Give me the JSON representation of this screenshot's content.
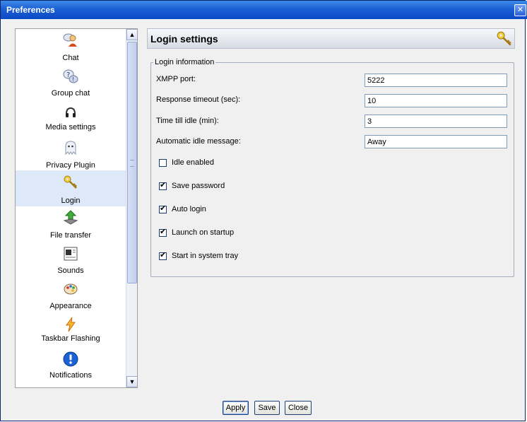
{
  "window": {
    "title": "Preferences",
    "close_glyph": "✕"
  },
  "sidebar": {
    "items": [
      {
        "label": "Chat",
        "icon": "chat-users-icon"
      },
      {
        "label": "Group chat",
        "icon": "group-chat-icon"
      },
      {
        "label": "Media settings",
        "icon": "headset-icon"
      },
      {
        "label": "Privacy Plugin",
        "icon": "ghost-icon"
      },
      {
        "label": "Login",
        "icon": "key-icon",
        "selected": true
      },
      {
        "label": "File transfer",
        "icon": "file-transfer-icon"
      },
      {
        "label": "Sounds",
        "icon": "sounds-icon"
      },
      {
        "label": "Appearance",
        "icon": "palette-icon"
      },
      {
        "label": "Taskbar Flashing",
        "icon": "lightning-icon"
      },
      {
        "label": "Notifications",
        "icon": "info-icon"
      }
    ],
    "scroll_up": "▲",
    "scroll_down": "▼"
  },
  "panel": {
    "title": "Login settings",
    "group_label": "Login information",
    "fields": [
      {
        "label": "XMPP port:",
        "value": "5222"
      },
      {
        "label": "Response timeout (sec):",
        "value": "10"
      },
      {
        "label": "Time till idle (min):",
        "value": "3"
      },
      {
        "label": "Automatic idle message:",
        "value": "Away"
      }
    ],
    "checkboxes": [
      {
        "label": "Idle enabled",
        "checked": false
      },
      {
        "label": "Save password",
        "checked": true
      },
      {
        "label": "Auto login",
        "checked": true
      },
      {
        "label": "Launch on startup",
        "checked": true
      },
      {
        "label": "Start in system tray",
        "checked": true
      }
    ],
    "check_glyph": "✔"
  },
  "buttons": {
    "apply": "Apply",
    "save": "Save",
    "close": "Close"
  },
  "colors": {
    "titlebar": "#1c5fd4",
    "selection": "#dde8f8",
    "border": "#7f9db9"
  }
}
